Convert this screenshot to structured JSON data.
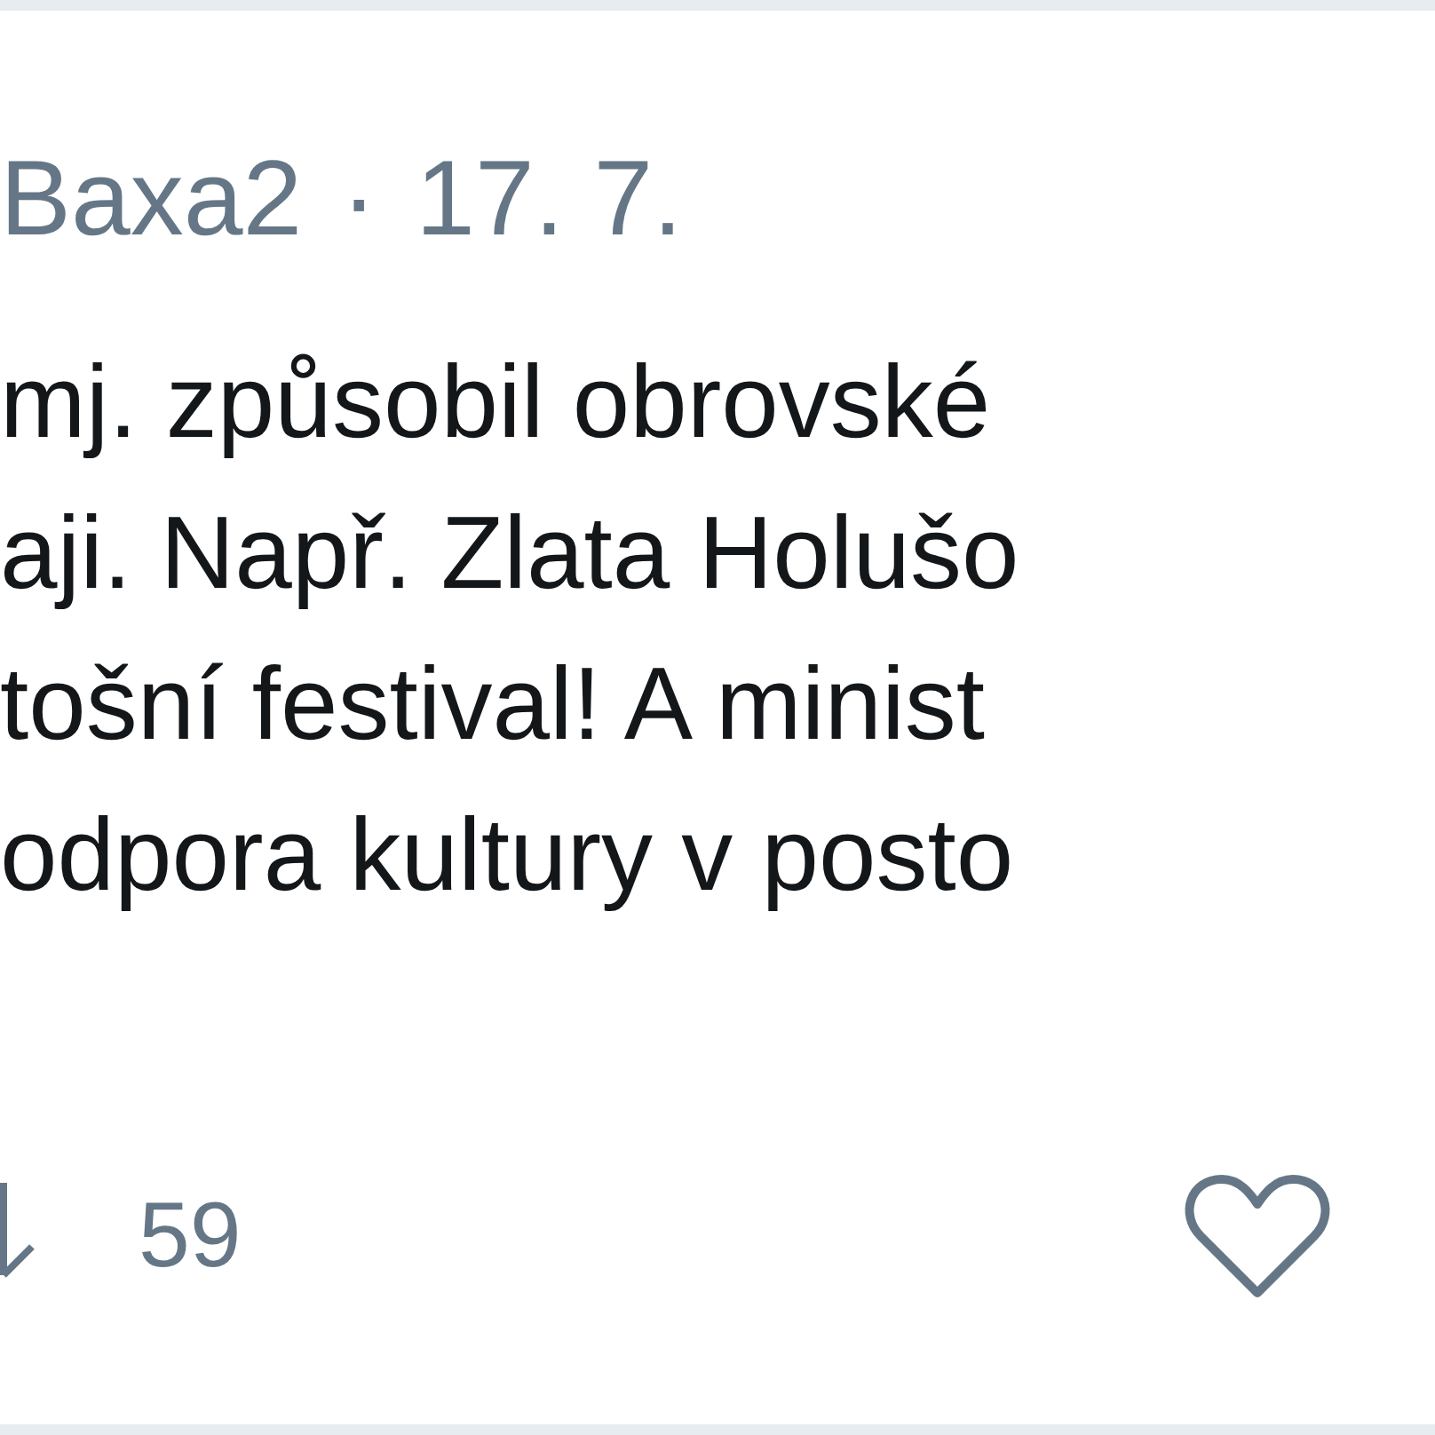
{
  "tweet": {
    "author": "Baxa2",
    "separator": "·",
    "date": "17. 7.",
    "lines": [
      "mj. způsobil obrovské",
      "aji. Např. Zlata Holušo",
      "tošní festival! A minist",
      "odpora kultury v posto"
    ],
    "retweet_count": "59"
  }
}
